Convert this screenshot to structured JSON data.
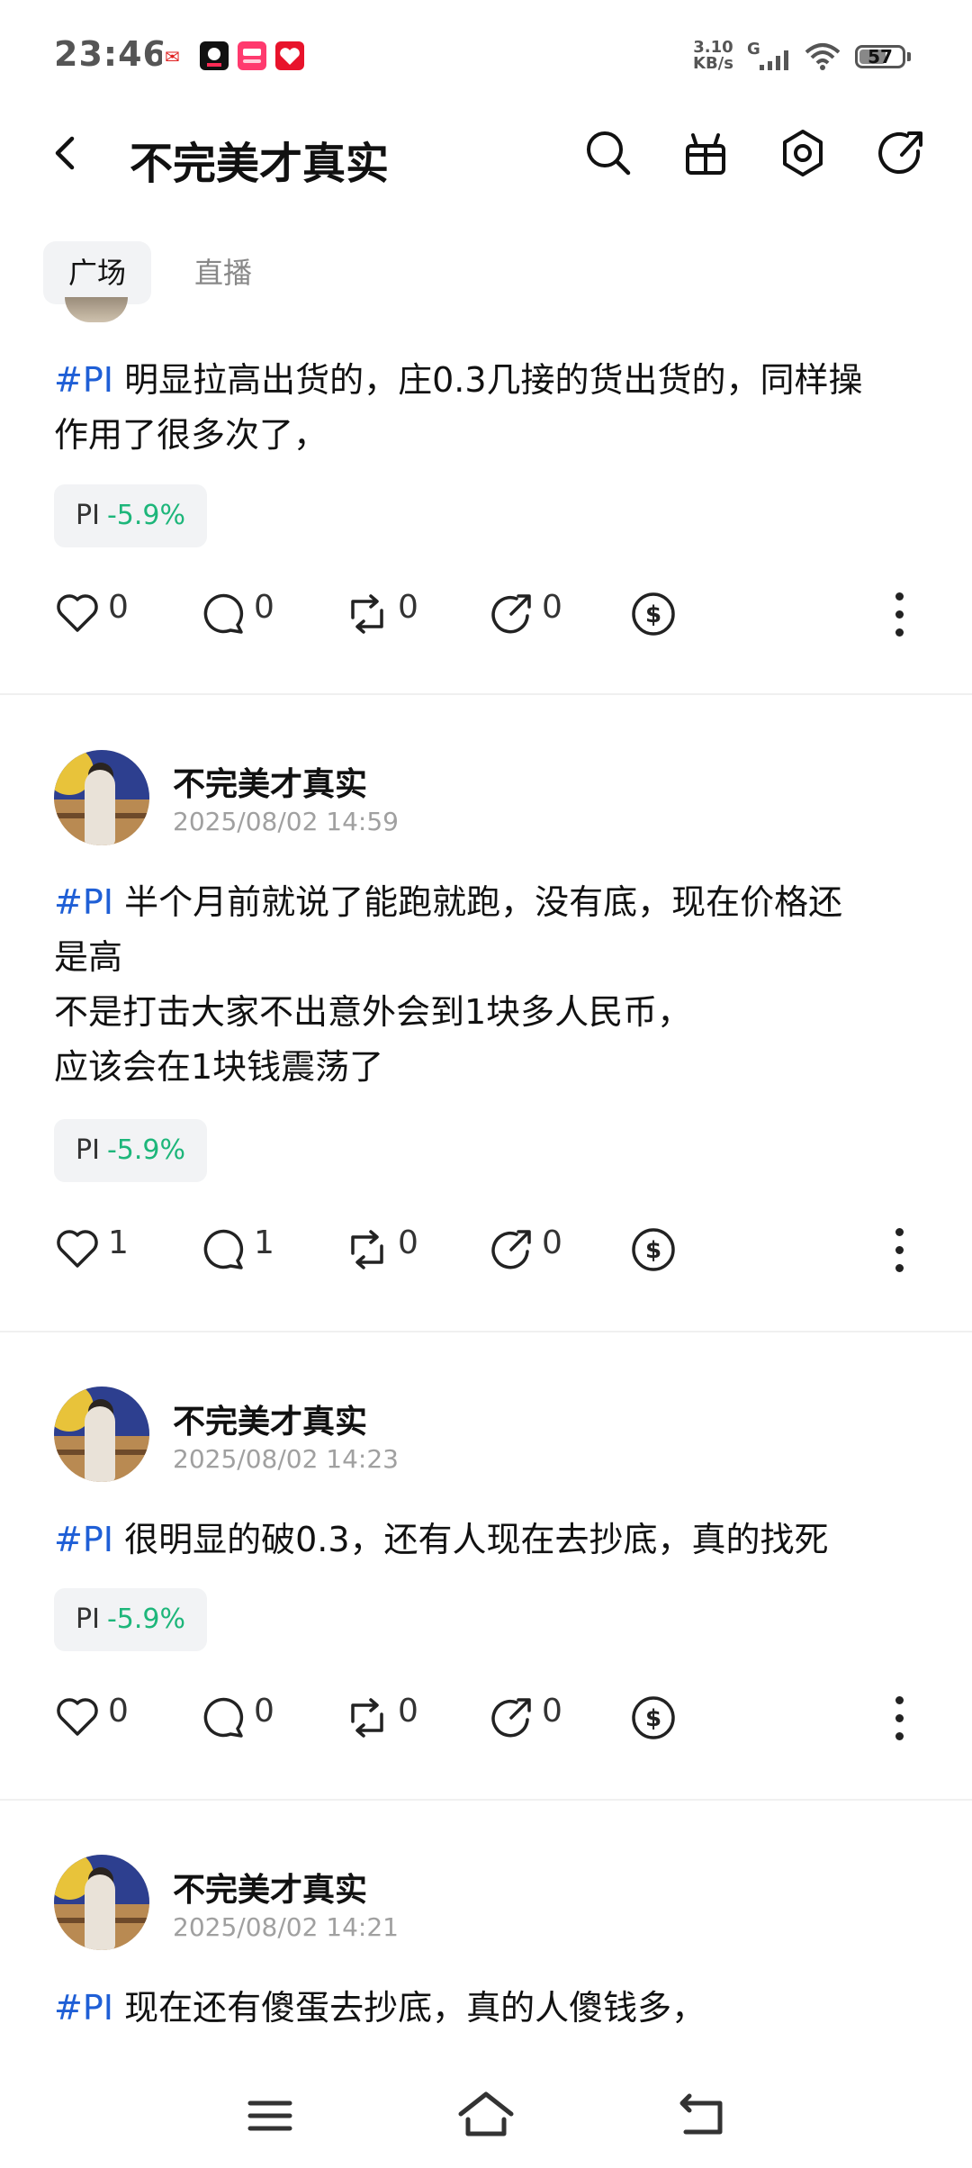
{
  "status_bar": {
    "time": "23:46",
    "net_speed_value": "3.10",
    "net_speed_unit": "KB/s",
    "network_gen": "G",
    "battery": "57"
  },
  "header": {
    "title": "不完美才真实"
  },
  "tabs": [
    {
      "label": "广场",
      "active": true
    },
    {
      "label": "直播",
      "active": false
    }
  ],
  "posts": [
    {
      "username": "",
      "timestamp": "",
      "hashtag": "#PI",
      "lines": [
        "明显拉高出货的，庄0.3几接的货出货的，同样操",
        "作用了很多次了，"
      ],
      "ticker": {
        "symbol": "PI",
        "change": "-5.9%"
      },
      "likes": "0",
      "comments": "0",
      "reposts": "0",
      "shares": "0"
    },
    {
      "username": "不完美才真实",
      "timestamp": "2025/08/02 14:59",
      "hashtag": "#PI",
      "lines": [
        "半个月前就说了能跑就跑，没有底，现在价格还",
        "是高",
        "不是打击大家不出意外会到1块多人民币，",
        "应该会在1块钱震荡了"
      ],
      "ticker": {
        "symbol": "PI",
        "change": "-5.9%"
      },
      "likes": "1",
      "comments": "1",
      "reposts": "0",
      "shares": "0"
    },
    {
      "username": "不完美才真实",
      "timestamp": "2025/08/02 14:23",
      "hashtag": "#PI",
      "lines": [
        "很明显的破0.3，还有人现在去抄底，真的找死"
      ],
      "ticker": {
        "symbol": "PI",
        "change": "-5.9%"
      },
      "likes": "0",
      "comments": "0",
      "reposts": "0",
      "shares": "0"
    },
    {
      "username": "不完美才真实",
      "timestamp": "2025/08/02 14:21",
      "hashtag": "#PI",
      "lines": [
        "现在还有傻蛋去抄底，真的人傻钱多，"
      ]
    }
  ],
  "colors": {
    "hashtag": "#1f5fd6",
    "negative_change": "#1db67a",
    "chip_bg": "#f2f3f5"
  }
}
